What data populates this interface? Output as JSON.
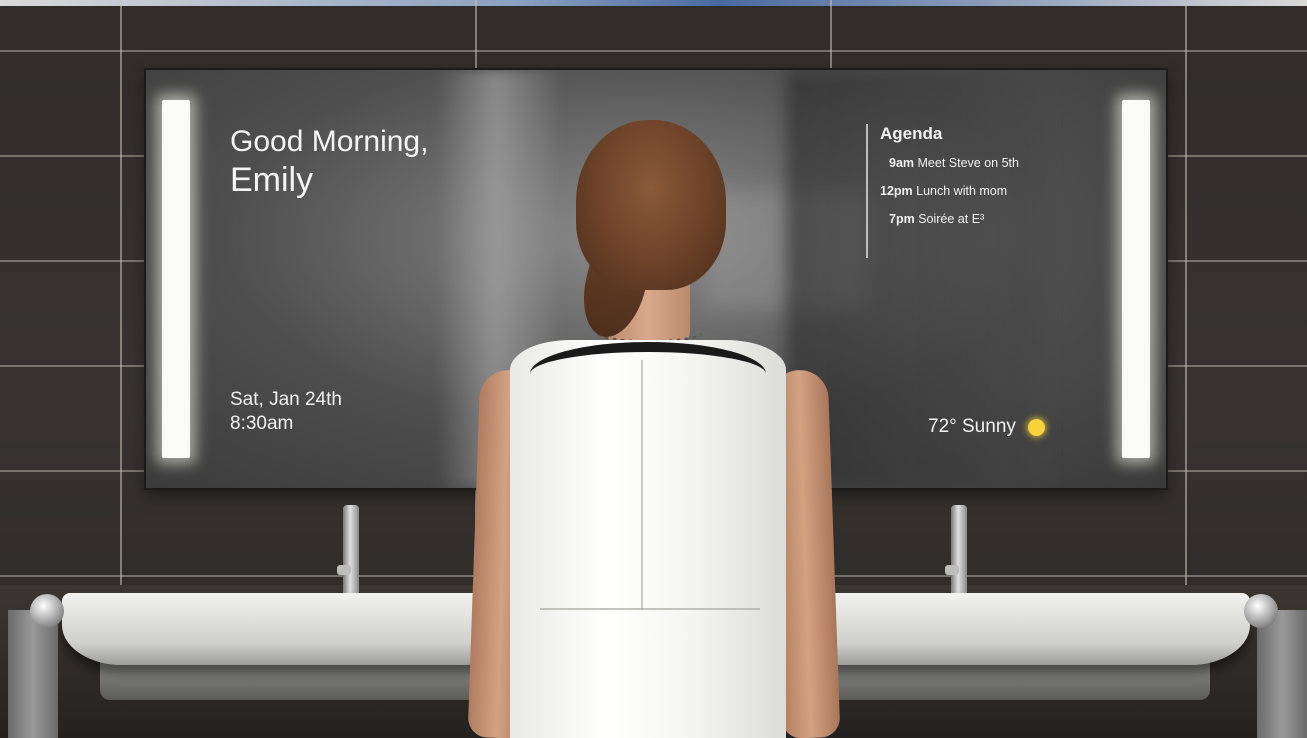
{
  "mirror_display": {
    "greeting_line1": "Good Morning,",
    "greeting_line2": "Emily",
    "date": "Sat, Jan 24th",
    "time": "8:30am",
    "agenda": {
      "title": "Agenda",
      "items": [
        {
          "time": "9am",
          "text": "Meet Steve on 5th"
        },
        {
          "time": "12pm",
          "text": "Lunch with mom"
        },
        {
          "time": "7pm",
          "text": "Soirée at E³"
        }
      ]
    },
    "weather": {
      "text": "72° Sunny",
      "icon": "sun-icon"
    }
  },
  "colors": {
    "text": "#f0f0f0",
    "sun": "#f7d23a",
    "light_bar": "#fbfbf6"
  }
}
